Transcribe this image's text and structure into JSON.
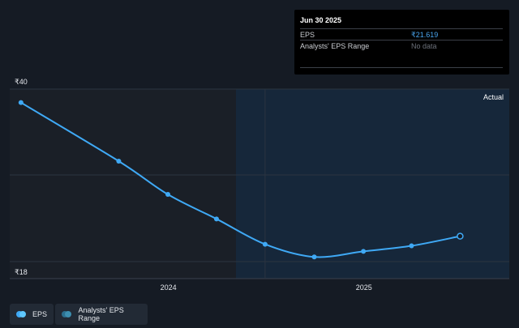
{
  "tooltip": {
    "date": "Jun 30 2025",
    "rows": [
      {
        "label": "EPS",
        "value": "₹21.619"
      },
      {
        "label": "Analysts' EPS Range",
        "value": "No data"
      }
    ]
  },
  "region_label": "Actual",
  "legend": [
    {
      "label": "EPS",
      "color": "#3fa9f5"
    },
    {
      "label": "Analysts' EPS Range",
      "color": "#2c6f8f"
    }
  ],
  "colors": {
    "background": "#151b24",
    "past_region": "#1a1f27",
    "actual_region": "#16273a",
    "line": "#3fa9f5"
  },
  "chart_data": {
    "type": "line",
    "title": "",
    "xlabel": "",
    "ylabel": "",
    "y_tick_labels": [
      "₹40",
      "₹18"
    ],
    "ylim": [
      18,
      40
    ],
    "x_tick_labels": [
      "2024",
      "2025"
    ],
    "x_ticks": [
      "2024-01-01",
      "2025-01-01"
    ],
    "xlim": [
      "2023-03-10",
      "2025-09-30"
    ],
    "grid": true,
    "actual_from": "2024-06-30",
    "series": [
      {
        "name": "EPS",
        "points": [
          {
            "x": "2023-03-31",
            "y": 38.5
          },
          {
            "x": "2023-09-30",
            "y": 31.1
          },
          {
            "x": "2023-12-31",
            "y": 26.9
          },
          {
            "x": "2024-03-31",
            "y": 23.8
          },
          {
            "x": "2024-06-30",
            "y": 20.6
          },
          {
            "x": "2024-09-30",
            "y": 19.0
          },
          {
            "x": "2024-12-31",
            "y": 19.7
          },
          {
            "x": "2025-03-31",
            "y": 20.4
          },
          {
            "x": "2025-06-30",
            "y": 21.619
          }
        ]
      }
    ]
  }
}
